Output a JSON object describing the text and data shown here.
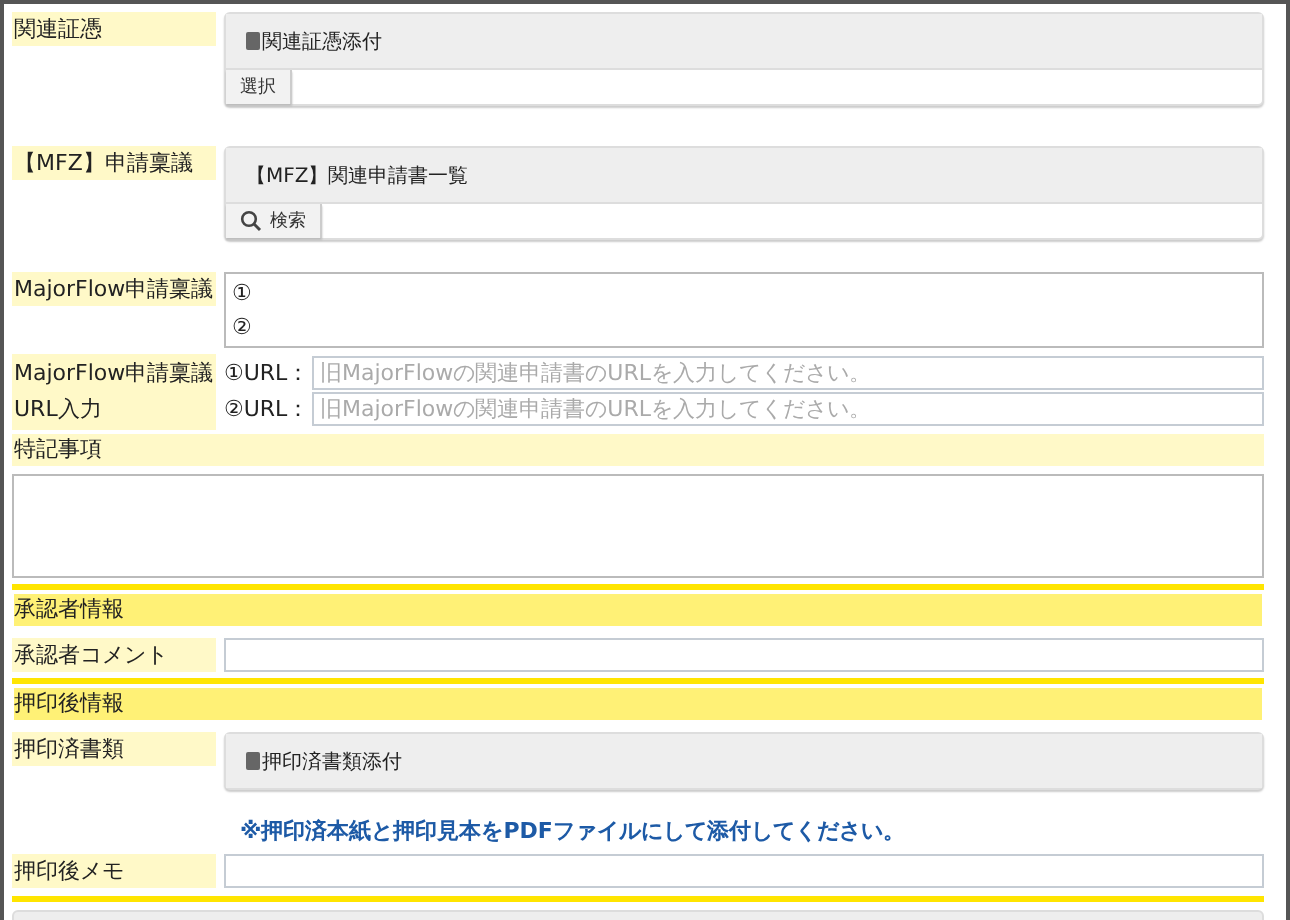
{
  "rows": [
    {
      "kind": "attach",
      "label": "関連証憑",
      "header": "関連証憑添付",
      "button": "選択"
    },
    {
      "kind": "search",
      "label": "【MFZ】申請稟議",
      "header": "【MFZ】関連申請書一覧",
      "button": "検索"
    },
    {
      "kind": "list",
      "label": "MajorFlow申請稟議",
      "items": [
        "①",
        "②"
      ]
    },
    {
      "kind": "urls",
      "label": "MajorFlow申請稟議 URL入力",
      "inputs": [
        {
          "label": "①URL：",
          "placeholder": "旧MajorFlowの関連申請書のURLを入力してください。"
        },
        {
          "label": "②URL：",
          "placeholder": "旧MajorFlowの関連申請書のURLを入力してください。"
        }
      ]
    },
    {
      "kind": "textarea",
      "label": "特記事項"
    },
    {
      "kind": "section",
      "label": "承認者情報"
    },
    {
      "kind": "input",
      "label": "承認者コメント"
    },
    {
      "kind": "section",
      "label": "押印後情報"
    },
    {
      "kind": "attach-note",
      "label": "押印済書類",
      "header": "押印済書類添付",
      "note": "※押印済本紙と押印見本をPDFファイルにして添付してください。"
    },
    {
      "kind": "input",
      "label": "押印後メモ"
    },
    {
      "kind": "panel"
    }
  ]
}
